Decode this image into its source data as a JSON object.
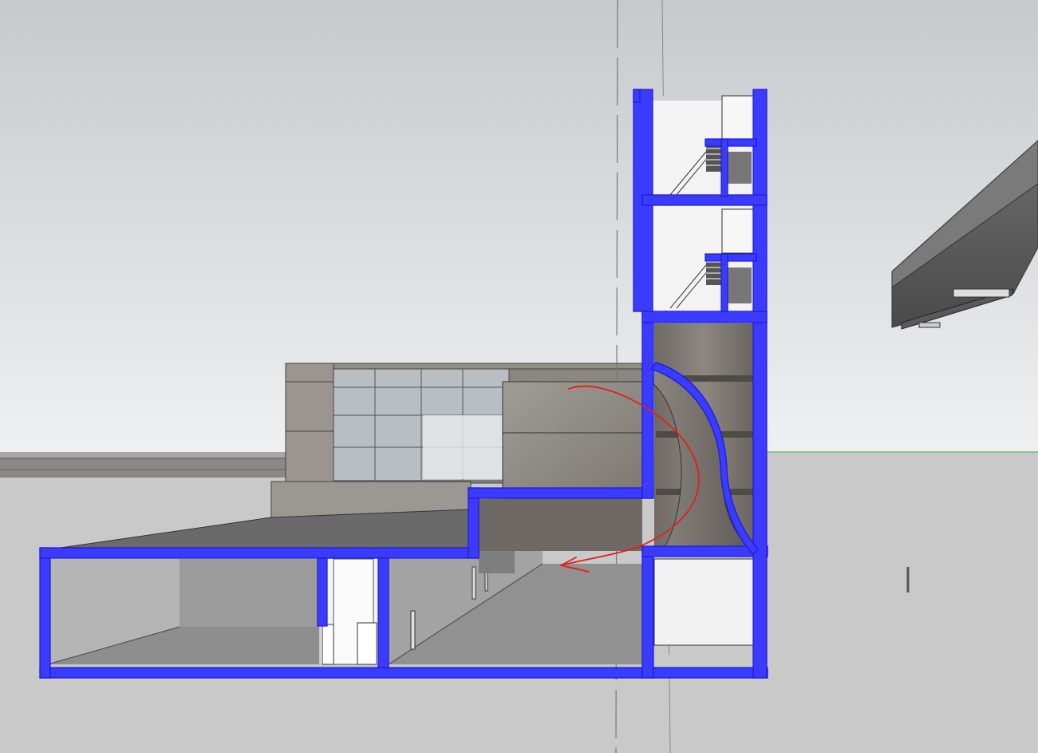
{
  "viewport": {
    "view": "section-perspective",
    "colors": {
      "sky_top": "#c6cacd",
      "sky_horizon": "#eceeef",
      "ground": "#c9c9c9",
      "section_cut": "#3b3bff",
      "annotation": "#e0201e",
      "concrete": "#8e8a86",
      "interior_white": "#f1f1f1",
      "green_axis": "#4caf50"
    }
  },
  "annotations": [
    {
      "kind": "freehand-arrow",
      "color": "#e0201e"
    }
  ]
}
